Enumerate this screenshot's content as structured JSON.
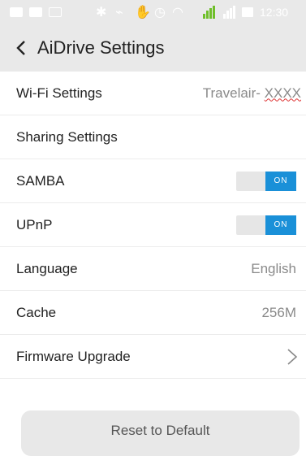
{
  "status_bar": {
    "time": "12:30"
  },
  "header": {
    "back_icon": "chevron-left-icon",
    "title": "AiDrive Settings"
  },
  "settings": {
    "wifi": {
      "label": "Wi-Fi Settings",
      "value_prefix": "Travelair- ",
      "value_suffix": "XXXX"
    },
    "sharing": {
      "label": "Sharing Settings"
    },
    "samba": {
      "label": "SAMBA",
      "toggle_text": "ON",
      "enabled": true
    },
    "upnp": {
      "label": "UPnP",
      "toggle_text": "ON",
      "enabled": true
    },
    "language": {
      "label": "Language",
      "value": "English"
    },
    "cache": {
      "label": "Cache",
      "value": "256M"
    },
    "firmware": {
      "label": "Firmware Upgrade",
      "icon": "chevron-right-icon"
    }
  },
  "reset_button": {
    "label": "Reset to Default"
  },
  "colors": {
    "toolbar_bg": "#e9e9e9",
    "toggle_on": "#1a90d8",
    "value_text": "#8a8a8a"
  }
}
